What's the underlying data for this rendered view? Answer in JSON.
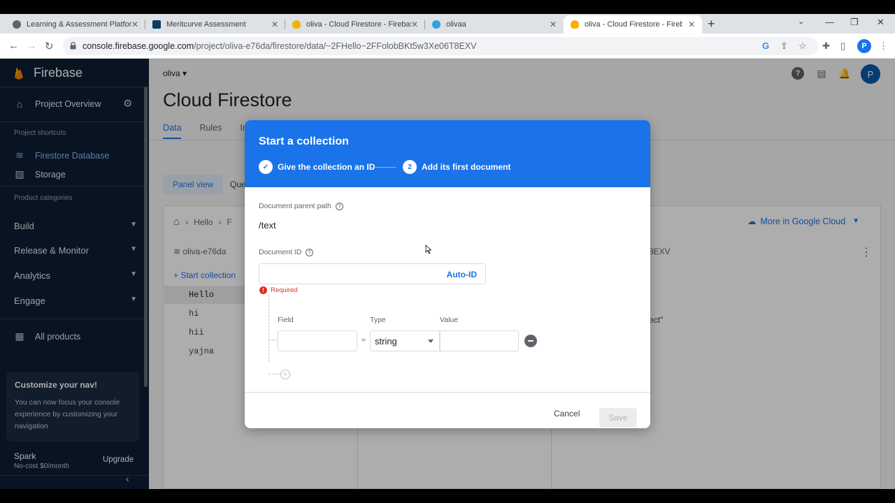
{
  "browser": {
    "tabs": [
      {
        "title": "Learning & Assessment Platform",
        "favicon_color": "#5f6368"
      },
      {
        "title": "Meritcurve Assessment",
        "favicon_color": "#0b3a63"
      },
      {
        "title": "oliva - Cloud Firestore - Firebase",
        "favicon_color": "#f6b100"
      },
      {
        "title": "olivaa",
        "favicon_color": "#2aa3df"
      },
      {
        "title": "oliva - Cloud Firestore - Firebase",
        "favicon_color": "#f6b100"
      }
    ],
    "active_tab_index": 4,
    "url_host": "console.firebase.google.com",
    "url_path": "/project/oliva-e76da/firestore/data/~2FHello~2FFolobBKt5w3Xe06T8EXV",
    "profile_initial": "P"
  },
  "sidebar": {
    "brand": "Firebase",
    "project_overview": "Project Overview",
    "shortcuts_caption": "Project shortcuts",
    "shortcuts": [
      {
        "label": "Firestore Database",
        "icon": "firestore-icon",
        "active": true
      },
      {
        "label": "Storage",
        "icon": "storage-icon",
        "active": false
      }
    ],
    "categories_caption": "Product categories",
    "categories": [
      "Build",
      "Release & Monitor",
      "Analytics",
      "Engage"
    ],
    "all_products": "All products",
    "customize_card": {
      "title": "Customize your nav!",
      "body": "You can now focus your console experience by customizing your navigation"
    },
    "plan_name": "Spark",
    "plan_detail": "No-cost $0/month",
    "upgrade_label": "Upgrade"
  },
  "main": {
    "project_selector": "oliva",
    "page_title": "Cloud Firestore",
    "tabs": [
      {
        "label": "Data",
        "active": true
      },
      {
        "label": "Rules",
        "active": false
      },
      {
        "label": "In",
        "active": false
      }
    ],
    "view_chip": "Panel view",
    "query_chip": "Que",
    "breadcrumb": [
      "Hello",
      "F"
    ],
    "more_in_cloud": "More in Google Cloud",
    "root_label": "oliva-e76da",
    "start_collection": "Start collection",
    "collections": [
      "Hello",
      "hi",
      "hii",
      "yajna"
    ],
    "selected_collection": "Hello",
    "doc_id_fragment": "8EXV",
    "field_fragment": "ect\"",
    "user_initial": "P"
  },
  "dialog": {
    "title": "Start a collection",
    "steps": [
      {
        "label": "Give the collection an ID",
        "marker": "✓"
      },
      {
        "label": "Add its first document",
        "marker": "2"
      }
    ],
    "parent_path_label": "Document parent path",
    "parent_path_value": "/text",
    "doc_id_label": "Document ID",
    "doc_id_value": "",
    "auto_id_label": "Auto-ID",
    "required_msg": "Required",
    "field_header": "Field",
    "type_header": "Type",
    "value_header": "Value",
    "field_value": "",
    "type_value": "string",
    "value_value": "",
    "equals": "=",
    "cancel_label": "Cancel",
    "save_label": "Save"
  },
  "colors": {
    "accent": "#1a73e8",
    "sidebar_bg": "#0d1e33",
    "error": "#d93025"
  }
}
